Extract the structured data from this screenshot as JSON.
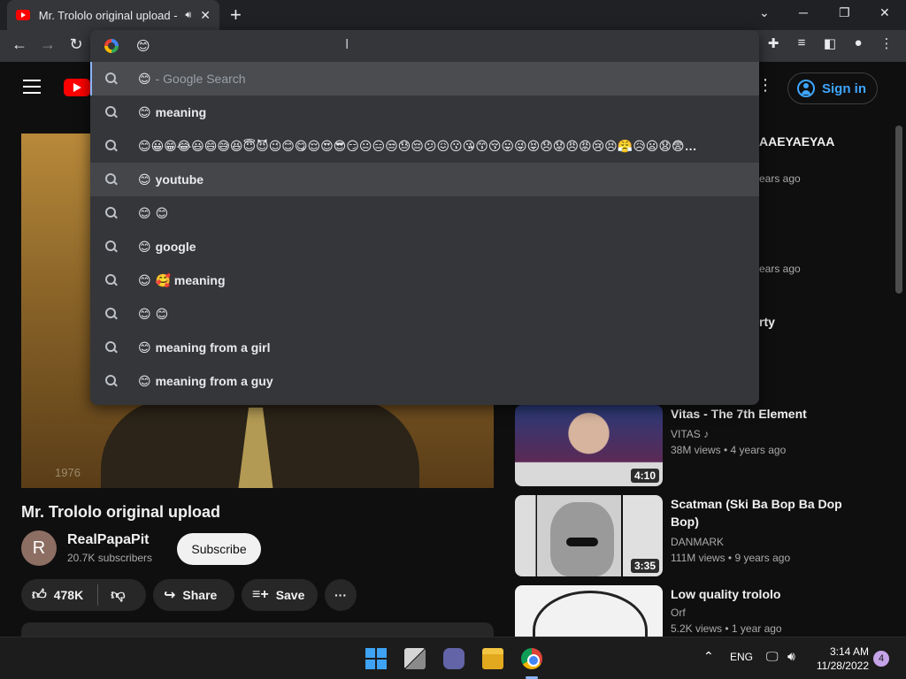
{
  "browser": {
    "tab_title": "Mr. Trololo original upload -",
    "tab_audio_icon": "speaker-icon",
    "new_tab_glyph": "+",
    "omnibox_text": "😊",
    "window_controls": {
      "minimize": "─",
      "maximize": "❐",
      "close": "✕",
      "tab_search": "⌄"
    }
  },
  "omnibox_suggestions": [
    {
      "prefix": "😊",
      "text": " - Google Search",
      "style": "muted",
      "state": "selected"
    },
    {
      "prefix": "😊",
      "text": " meaning",
      "style": "bold",
      "state": ""
    },
    {
      "prefix": "",
      "text": "😊😀😁😂😃😄😅😆😇😈😉😊😋😌😍😎😏😐😑😒😓😔😕😖😗😘😙😚😛😜😝😞😟😠😡😢😣😤😥😦😧😨…",
      "style": "bold",
      "state": ""
    },
    {
      "prefix": "😊",
      "text": "youtube",
      "style": "bold",
      "state": "hover"
    },
    {
      "prefix": "😊",
      "text": " 😊",
      "style": "bold",
      "state": ""
    },
    {
      "prefix": "😊",
      "text": "google",
      "style": "bold",
      "state": ""
    },
    {
      "prefix": "😊",
      "text": " 🥰 meaning",
      "style": "bold",
      "state": ""
    },
    {
      "prefix": "😊",
      "text": " 😊",
      "style": "bold",
      "state": ""
    },
    {
      "prefix": "😊",
      "text": " meaning from a girl",
      "style": "bold",
      "state": ""
    },
    {
      "prefix": "😊",
      "text": " meaning from a guy",
      "style": "bold",
      "state": ""
    }
  ],
  "youtube": {
    "sign_in": "Sign in",
    "video_year_overlay": "1976",
    "video_title": "Mr. Trololo original upload",
    "channel": {
      "initial": "R",
      "name": "RealPapaPit",
      "subs": "20.7K subscribers"
    },
    "subscribe": "Subscribe",
    "likes": "478K",
    "share": "Share",
    "save": "Save",
    "more": "···",
    "partial_related": [
      {
        "text": "AAEYAEYAA",
        "kind": "title"
      },
      {
        "text": "ears ago",
        "kind": "meta"
      },
      {
        "text": "ears ago",
        "kind": "meta"
      },
      {
        "text": "rty",
        "kind": "title"
      }
    ],
    "related": [
      {
        "title": "Vitas - The 7th Element",
        "channel": "VITAS ♪",
        "meta": "38M views  • 4 years ago",
        "duration": "4:10",
        "thumb": "thumb-vitas"
      },
      {
        "title": "Scatman (Ski Ba Bop Ba Dop Bop)",
        "channel": "DANMARK",
        "meta": "111M views  • 9 years ago",
        "duration": "3:35",
        "thumb": "thumb-scat"
      },
      {
        "title": "Low quality trololo",
        "channel": "Orf",
        "meta": "5.2K views  • 1 year ago",
        "duration": "",
        "thumb": "thumb-troll"
      }
    ]
  },
  "taskbar": {
    "language": "ENG",
    "time": "3:14 AM",
    "date": "11/28/2022",
    "notifications": "4"
  },
  "colors": {
    "accent_blue": "#3ea6ff",
    "youtube_red": "#ff0000",
    "omnibox_bg": "#35363a"
  }
}
